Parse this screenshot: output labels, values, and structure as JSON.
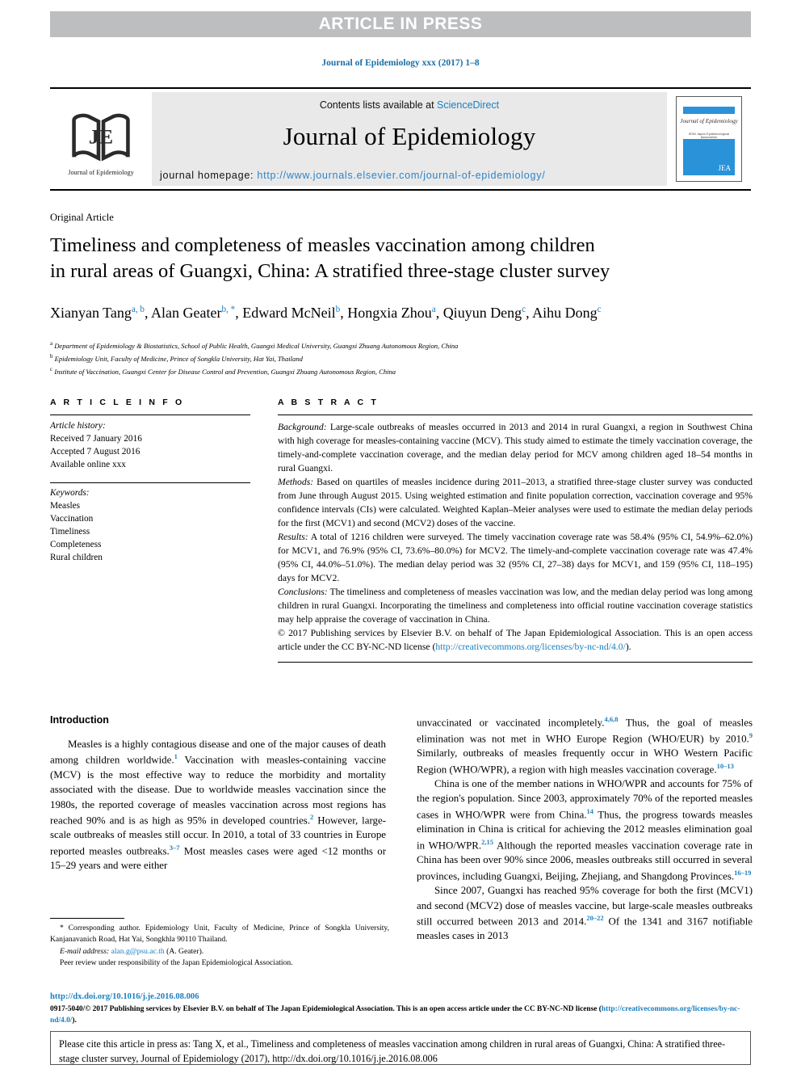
{
  "banner": {
    "text": "ARTICLE IN PRESS"
  },
  "running_head": {
    "text": "Journal of Epidemiology xxx (2017) 1–8"
  },
  "masthead": {
    "logo_caption": "Journal of Epidemiology",
    "logo_letters": "JE",
    "contents_prefix": "Contents lists available at ",
    "contents_link": "ScienceDirect",
    "journal_title": "Journal of Epidemiology",
    "homepage_label": "journal homepage: ",
    "homepage_url": "http://www.journals.elsevier.com/journal-of-epidemiology/",
    "cover": {
      "name": "Journal of Epidemiology",
      "subtitle": "ISSN  Japan Epidemiological Association",
      "mark": "JEA"
    }
  },
  "article": {
    "kind": "Original Article",
    "title_line1": "Timeliness and completeness of measles vaccination among children",
    "title_line2": "in rural areas of Guangxi, China: A stratified three-stage cluster survey",
    "authors": [
      {
        "name": "Xianyan Tang",
        "marks": "a, b",
        "sep": ", "
      },
      {
        "name": "Alan Geater",
        "marks": "b, *",
        "sep": ", "
      },
      {
        "name": "Edward McNeil",
        "marks": "b",
        "sep": ", "
      },
      {
        "name": "Hongxia Zhou",
        "marks": "a",
        "sep": ", "
      },
      {
        "name": "Qiuyun Deng",
        "marks": "c",
        "sep": ", "
      },
      {
        "name": "Aihu Dong",
        "marks": "c",
        "sep": ""
      }
    ],
    "affiliations": [
      {
        "mark": "a",
        "text": "Department of Epidemiology & Biostatistics, School of Public Health, Guangxi Medical University, Guangxi Zhuang Autonomous Region, China"
      },
      {
        "mark": "b",
        "text": "Epidemiology Unit, Faculty of Medicine, Prince of Songkla University, Hat Yai, Thailand"
      },
      {
        "mark": "c",
        "text": "Institute of Vaccination, Guangxi Center for Disease Control and Prevention, Guangxi Zhuang Autonomous Region, China"
      }
    ]
  },
  "article_info": {
    "heading": "A R T I C L E  I N F O",
    "history_label": "Article history:",
    "history": [
      "Received 7 January 2016",
      "Accepted 7 August 2016",
      "Available online xxx"
    ],
    "keywords_label": "Keywords:",
    "keywords": [
      "Measles",
      "Vaccination",
      "Timeliness",
      "Completeness",
      "Rural children"
    ]
  },
  "abstract": {
    "heading": "A B S T R A C T",
    "background_label": "Background:",
    "background": " Large-scale outbreaks of measles occurred in 2013 and 2014 in rural Guangxi, a region in Southwest China with high coverage for measles-containing vaccine (MCV). This study aimed to estimate the timely vaccination coverage, the timely-and-complete vaccination coverage, and the median delay period for MCV among children aged 18–54 months in rural Guangxi.",
    "methods_label": "Methods:",
    "methods": " Based on quartiles of measles incidence during 2011–2013, a stratified three-stage cluster survey was conducted from June through August 2015. Using weighted estimation and finite population correction, vaccination coverage and 95% confidence intervals (CIs) were calculated. Weighted Kaplan–Meier analyses were used to estimate the median delay periods for the first (MCV1) and second (MCV2) doses of the vaccine.",
    "results_label": "Results:",
    "results": " A total of 1216 children were surveyed. The timely vaccination coverage rate was 58.4% (95% CI, 54.9%–62.0%) for MCV1, and 76.9% (95% CI, 73.6%–80.0%) for MCV2. The timely-and-complete vaccination coverage rate was 47.4% (95% CI, 44.0%–51.0%). The median delay period was 32 (95% CI, 27–38) days for MCV1, and 159 (95% CI, 118–195) days for MCV2.",
    "conclusions_label": "Conclusions:",
    "conclusions": " The timeliness and completeness of measles vaccination was low, and the median delay period was long among children in rural Guangxi. Incorporating the timeliness and completeness into official routine vaccination coverage statistics may help appraise the coverage of vaccination in China.",
    "license_prefix": "© 2017 Publishing services by Elsevier B.V. on behalf of The Japan Epidemiological Association. This is an open access article under the CC BY-NC-ND license (",
    "license_url": "http://creativecommons.org/licenses/by-nc-nd/4.0/",
    "license_suffix": ")."
  },
  "body": {
    "intro_heading": "Introduction",
    "left_paragraphs": [
      {
        "runs": [
          {
            "t": "Measles is a highly contagious disease and one of the major causes of death among children worldwide."
          },
          {
            "t": "1",
            "sup": true
          },
          {
            "t": " Vaccination with measles-containing vaccine (MCV) is the most effective way to reduce the morbidity and mortality associated with the disease. Due to worldwide measles vaccination since the 1980s, the reported coverage of measles vaccination across most regions has reached 90% and is as high as 95% in developed countries."
          },
          {
            "t": "2",
            "sup": true
          },
          {
            "t": " However, large-scale outbreaks of measles still occur. In 2010, a total of 33 countries in Europe reported measles outbreaks."
          },
          {
            "t": "3–7",
            "sup": true
          },
          {
            "t": " Most measles cases were aged <12 months or 15–29 years and were either"
          }
        ]
      }
    ],
    "right_paragraphs": [
      {
        "runs": [
          {
            "t": "unvaccinated or vaccinated incompletely."
          },
          {
            "t": "4,6,8",
            "sup": true
          },
          {
            "t": " Thus, the goal of measles elimination was not met in WHO Europe Region (WHO/EUR) by 2010."
          },
          {
            "t": "9",
            "sup": true
          },
          {
            "t": " Similarly, outbreaks of measles frequently occur in WHO Western Pacific Region (WHO/WPR), a region with high measles vaccination coverage."
          },
          {
            "t": "10–13",
            "sup": true
          }
        ],
        "no_indent": true
      },
      {
        "runs": [
          {
            "t": "China is one of the member nations in WHO/WPR and accounts for 75% of the region's population. Since 2003, approximately 70% of the reported measles cases in WHO/WPR were from China."
          },
          {
            "t": "14",
            "sup": true
          },
          {
            "t": " Thus, the progress towards measles elimination in China is critical for achieving the 2012 measles elimination goal in WHO/WPR."
          },
          {
            "t": "2,15",
            "sup": true
          },
          {
            "t": " Although the reported measles vaccination coverage rate in China has been over 90% since 2006, measles outbreaks still occurred in several provinces, including Guangxi, Beijing, Zhejiang, and Shangdong Provinces."
          },
          {
            "t": "16–19",
            "sup": true
          }
        ]
      },
      {
        "runs": [
          {
            "t": "Since 2007, Guangxi has reached 95% coverage for both the first (MCV1) and second (MCV2) dose of measles vaccine, but large-scale measles outbreaks still occurred between 2013 and 2014."
          },
          {
            "t": "20–22",
            "sup": true
          },
          {
            "t": " Of the 1341 and 3167 notifiable measles cases in 2013"
          }
        ]
      }
    ]
  },
  "footnotes": {
    "corresponding": "* Corresponding author. Epidemiology Unit, Faculty of Medicine, Prince of Songkla University, Kanjanavanich Road, Hat Yai, Songkhla 90110 Thailand.",
    "email_label": "E-mail address:",
    "email": "alan.g@psu.ac.th",
    "email_suffix": " (A. Geater).",
    "peer_review": "Peer review under responsibility of the Japan Epidemiological Association."
  },
  "footer": {
    "doi": "http://dx.doi.org/10.1016/j.je.2016.08.006",
    "copyright_prefix": "0917-5040/© 2017 Publishing services by Elsevier B.V. on behalf of The Japan Epidemiological Association. This is an open access article under the CC BY-NC-ND license (",
    "copyright_url": "http://creativecommons.org/licenses/by-nc-nd/4.0/",
    "copyright_suffix": ").",
    "citation": "Please cite this article in press as: Tang X, et al., Timeliness and completeness of measles vaccination among children in rural areas of Guangxi, China: A stratified three-stage cluster survey, Journal of Epidemiology (2017), http://dx.doi.org/10.1016/j.je.2016.08.006"
  },
  "colors": {
    "banner_bg": "#bcbec0",
    "link_blue": "#1a7fc1",
    "cover_blue": "#2a92d8",
    "masthead_bg": "#e9e9e9"
  }
}
